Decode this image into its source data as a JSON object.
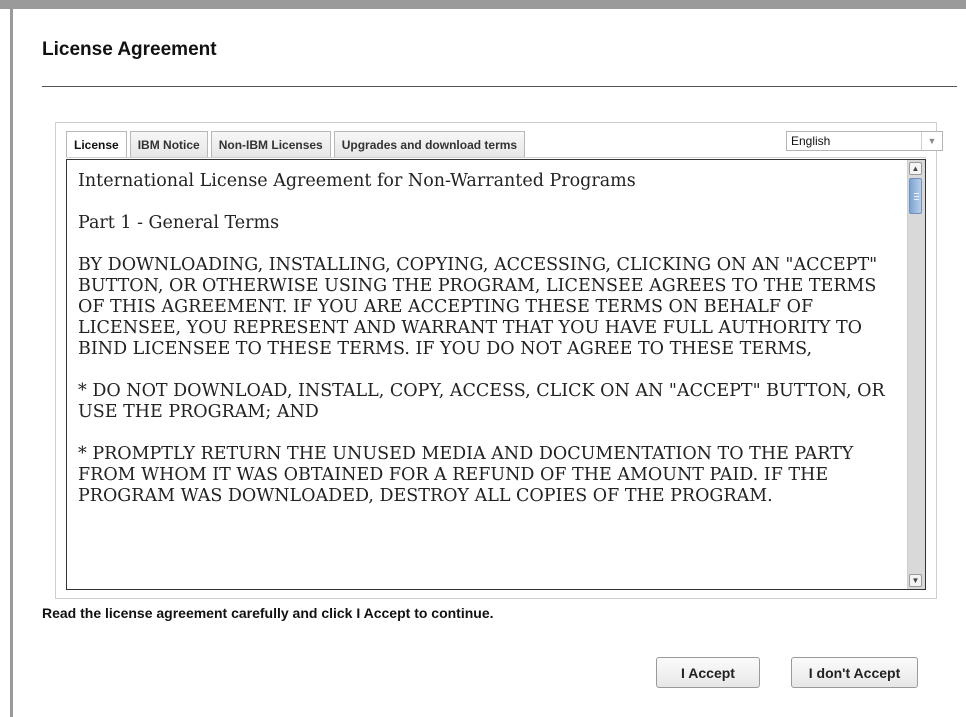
{
  "dialog": {
    "title": "License Agreement"
  },
  "tabs": [
    {
      "label": "License",
      "active": true
    },
    {
      "label": "IBM Notice",
      "active": false
    },
    {
      "label": "Non-IBM Licenses",
      "active": false
    },
    {
      "label": "Upgrades and download terms",
      "active": false
    }
  ],
  "language_select": {
    "selected": "English"
  },
  "license": {
    "paragraphs": [
      "International License Agreement for Non-Warranted Programs",
      "Part 1 - General Terms",
      "BY DOWNLOADING, INSTALLING, COPYING, ACCESSING, CLICKING ON AN \"ACCEPT\" BUTTON, OR OTHERWISE USING THE PROGRAM, LICENSEE AGREES TO THE TERMS OF THIS AGREEMENT. IF YOU ARE ACCEPTING THESE TERMS ON BEHALF OF LICENSEE, YOU REPRESENT AND WARRANT THAT YOU HAVE FULL AUTHORITY TO BIND LICENSEE TO THESE TERMS. IF YOU DO NOT AGREE TO THESE TERMS,",
      "* DO NOT DOWNLOAD, INSTALL, COPY, ACCESS, CLICK ON AN \"ACCEPT\" BUTTON, OR USE THE PROGRAM; AND",
      "* PROMPTLY RETURN THE UNUSED MEDIA AND DOCUMENTATION TO THE PARTY FROM WHOM IT WAS OBTAINED FOR A REFUND OF THE AMOUNT PAID. IF THE PROGRAM WAS DOWNLOADED, DESTROY ALL COPIES OF THE PROGRAM."
    ]
  },
  "instruction": "Read the license agreement carefully and click I Accept to continue.",
  "buttons": {
    "accept": "I Accept",
    "decline": "I don't Accept"
  },
  "icons": {
    "scroll_up": "chevron-up-icon",
    "scroll_down": "chevron-down-icon",
    "dropdown": "chevron-down-icon"
  }
}
